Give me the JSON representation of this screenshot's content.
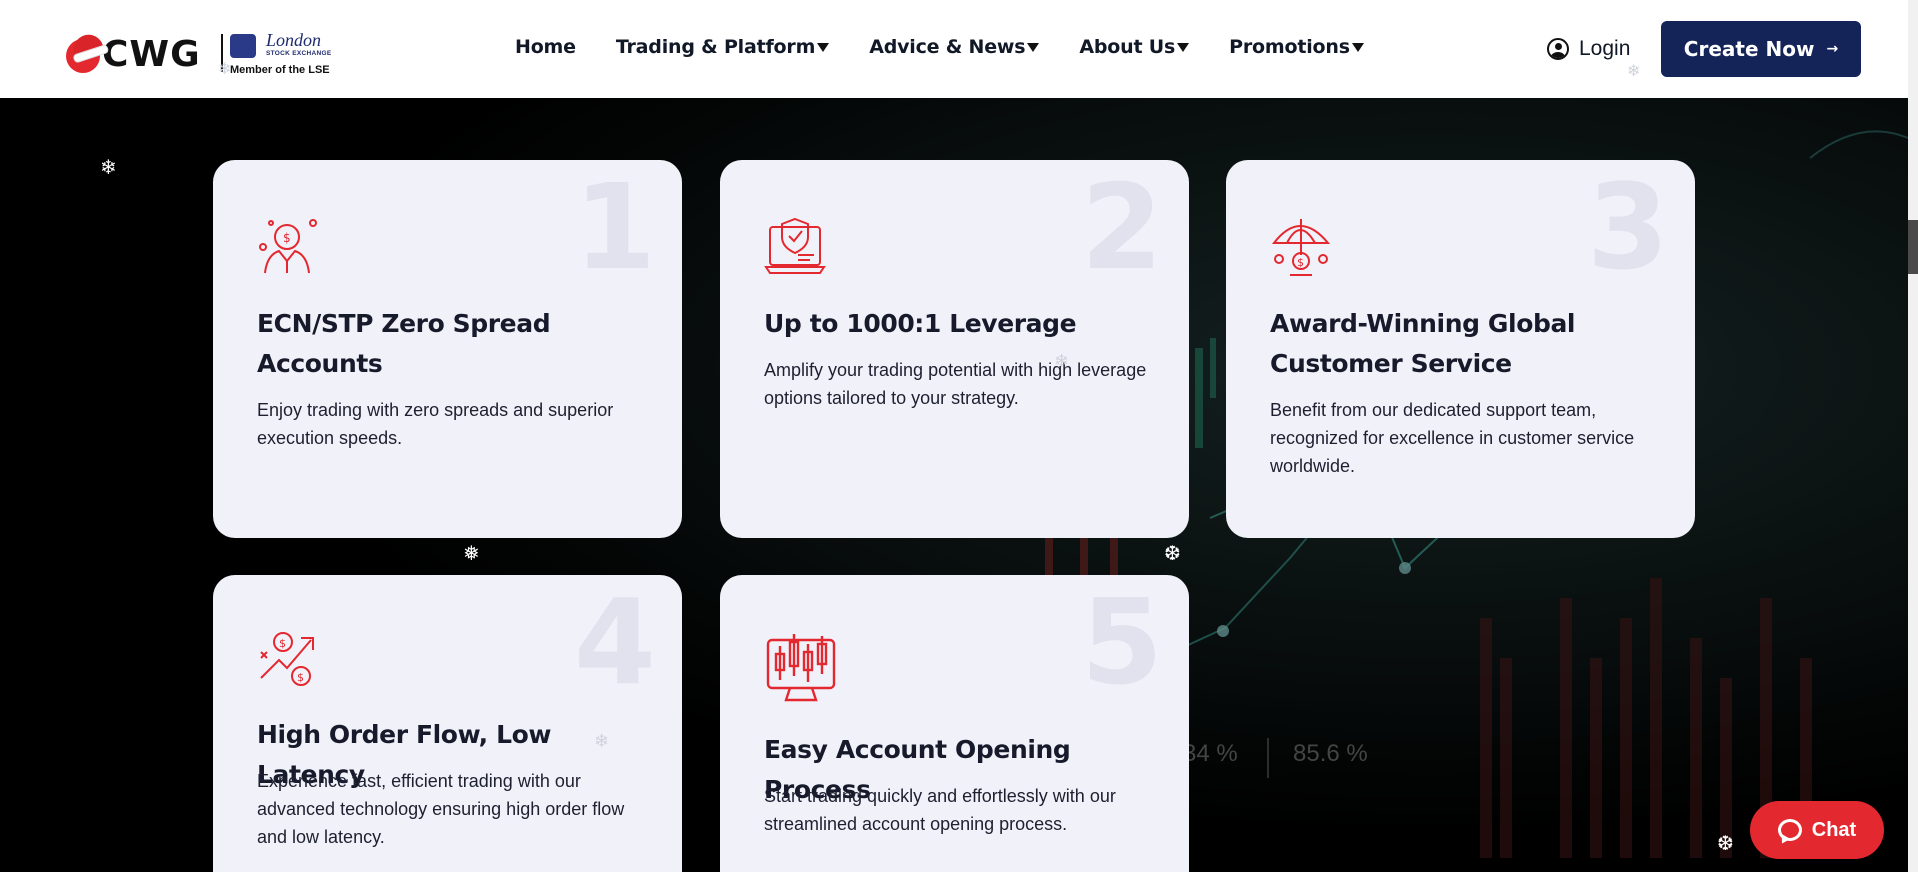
{
  "header": {
    "logo": {
      "brand": "CWG",
      "lse_city": "London",
      "lse_exchange": "STOCK EXCHANGE",
      "lse_member": "Member of the LSE"
    },
    "nav": [
      {
        "label": "Home",
        "has_dropdown": false
      },
      {
        "label": "Trading & Platform",
        "has_dropdown": true
      },
      {
        "label": "Advice & News",
        "has_dropdown": true
      },
      {
        "label": "About Us",
        "has_dropdown": true
      },
      {
        "label": "Promotions",
        "has_dropdown": true
      }
    ],
    "login_label": "Login",
    "create_label": "Create Now",
    "create_arrow": "→"
  },
  "cards": [
    {
      "number": "1",
      "icon": "investor-coin-icon",
      "title": "ECN/STP Zero Spread Accounts",
      "desc": "Enjoy trading with zero spreads and superior execution speeds."
    },
    {
      "number": "2",
      "icon": "laptop-shield-icon",
      "title": "Up to 1000:1 Leverage",
      "desc": "Amplify your trading potential with high leverage options tailored to your strategy."
    },
    {
      "number": "3",
      "icon": "umbrella-coin-icon",
      "title": "Award-Winning Global Customer Service",
      "desc": "Benefit from our dedicated support team, recognized for excellence in customer service worldwide."
    },
    {
      "number": "4",
      "icon": "growth-coins-icon",
      "title": "High Order Flow, Low Latency",
      "desc": "Experience fast, efficient trading with our advanced technology ensuring high order flow and low latency."
    },
    {
      "number": "5",
      "icon": "candlestick-monitor-icon",
      "title": "Easy Account Opening Process",
      "desc": "Start trading quickly and effortlessly with our streamlined account opening process."
    }
  ],
  "background": {
    "stat_left": "34 %",
    "stat_right": "85.6 %"
  },
  "widgets": {
    "chat_label": "Chat",
    "top_arrow": "↑"
  },
  "colors": {
    "brand_red": "#e3282f",
    "brand_navy": "#152458",
    "card_bg": "#f1f1f9"
  }
}
